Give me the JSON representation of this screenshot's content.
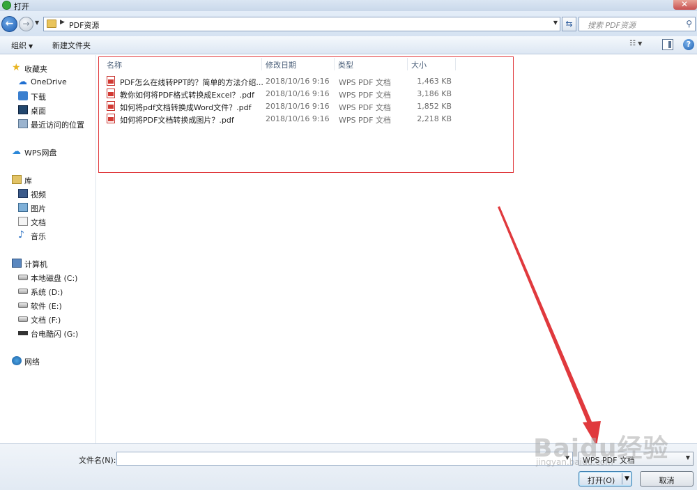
{
  "window": {
    "title": "打开",
    "close_label": "✕"
  },
  "navigation": {
    "address_path": "PDF资源",
    "search_placeholder": "搜索 PDF资源"
  },
  "toolbar": {
    "organize_label": "组织",
    "new_folder_label": "新建文件夹"
  },
  "sidebar": {
    "items": [
      {
        "label": "收藏夹",
        "icon": "star-icon"
      },
      {
        "label": "OneDrive",
        "icon": "cloud-icon"
      },
      {
        "label": "下载",
        "icon": "download-folder-icon"
      },
      {
        "label": "桌面",
        "icon": "desktop-icon"
      },
      {
        "label": "最近访问的位置",
        "icon": "recent-places-icon"
      },
      {
        "label": "WPS网盘",
        "icon": "wps-cloud-icon"
      },
      {
        "label": "库",
        "icon": "library-icon"
      },
      {
        "label": "视频",
        "icon": "video-icon"
      },
      {
        "label": "图片",
        "icon": "pictures-icon"
      },
      {
        "label": "文档",
        "icon": "documents-icon"
      },
      {
        "label": "音乐",
        "icon": "music-icon"
      },
      {
        "label": "计算机",
        "icon": "computer-icon"
      },
      {
        "label": "本地磁盘 (C:)",
        "icon": "drive-icon"
      },
      {
        "label": "系统 (D:)",
        "icon": "drive-icon"
      },
      {
        "label": "软件 (E:)",
        "icon": "drive-icon"
      },
      {
        "label": "文档 (F:)",
        "icon": "drive-icon"
      },
      {
        "label": "台电酷闪 (G:)",
        "icon": "usb-drive-icon"
      },
      {
        "label": "网络",
        "icon": "network-icon"
      }
    ]
  },
  "file_list": {
    "columns": [
      "名称",
      "修改日期",
      "类型",
      "大小"
    ],
    "rows": [
      {
        "name": "PDF怎么在线转PPT的？简单的方法介绍...",
        "date": "2018/10/16 9:16",
        "type": "WPS PDF 文档",
        "size": "1,463 KB"
      },
      {
        "name": "教你如何将PDF格式转换成Excel？.pdf",
        "date": "2018/10/16 9:16",
        "type": "WPS PDF 文档",
        "size": "3,186 KB"
      },
      {
        "name": "如何将pdf文档转换成Word文件？.pdf",
        "date": "2018/10/16 9:16",
        "type": "WPS PDF 文档",
        "size": "1,852 KB"
      },
      {
        "name": "如何将PDF文档转换成图片？.pdf",
        "date": "2018/10/16 9:16",
        "type": "WPS PDF 文档",
        "size": "2,218 KB"
      }
    ]
  },
  "footer": {
    "filename_label": "文件名(N):",
    "filename_value": "",
    "filetype_value": "WPS PDF 文档",
    "open_label": "打开(O)",
    "cancel_label": "取消"
  },
  "watermark": {
    "brand": "Baidu经验",
    "url": "jingyan.baidu.com"
  },
  "colors": {
    "highlight": "#e0393d",
    "accent": "#1f5fb4"
  }
}
